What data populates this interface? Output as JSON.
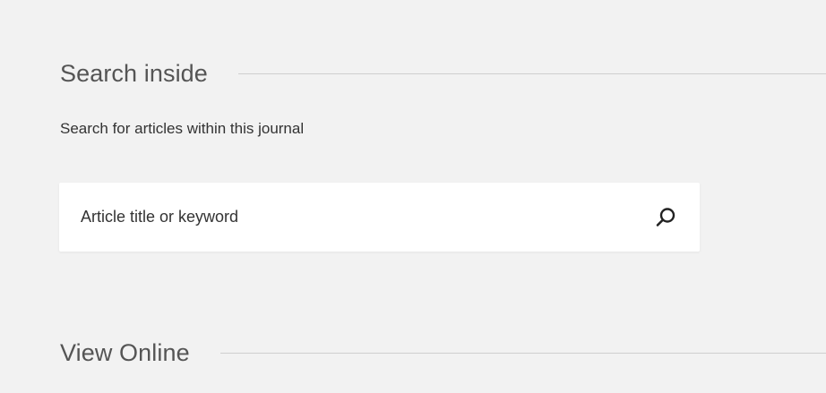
{
  "search_section": {
    "title": "Search inside",
    "subtitle": "Search for articles within this journal",
    "input": {
      "placeholder": "Article title or keyword",
      "value": ""
    },
    "submit_icon": "search-icon"
  },
  "view_section": {
    "title": "View Online"
  },
  "colors": {
    "background": "#f2f2f2",
    "input_background": "#ffffff",
    "text": "#333333",
    "heading": "#555555",
    "rule": "#cfcfcf"
  }
}
